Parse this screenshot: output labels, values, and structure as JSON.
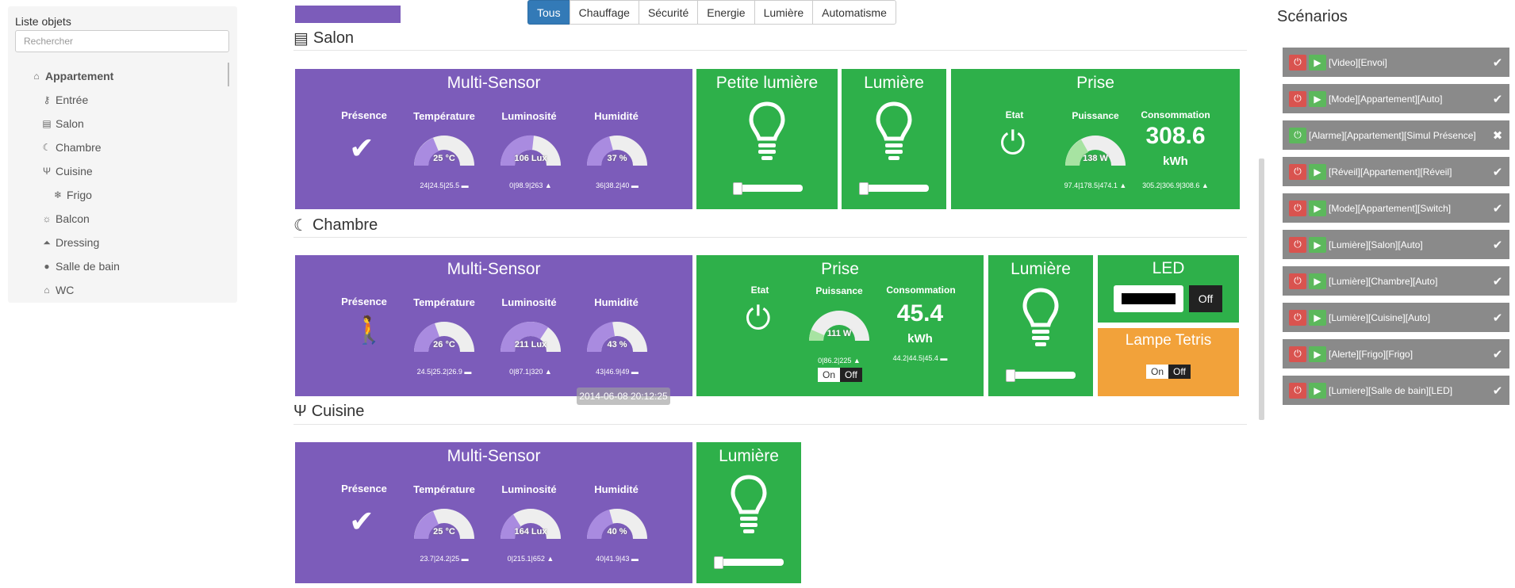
{
  "sidebar": {
    "title": "Liste objets",
    "search_placeholder": "Rechercher",
    "items": [
      {
        "label": "Appartement",
        "icon": "home-icon"
      },
      {
        "label": "Entrée",
        "icon": "key-icon"
      },
      {
        "label": "Salon",
        "icon": "film-icon"
      },
      {
        "label": "Chambre",
        "icon": "moon-icon"
      },
      {
        "label": "Cuisine",
        "icon": "cutlery-icon"
      },
      {
        "label": "Frigo",
        "icon": "snowflake-icon"
      },
      {
        "label": "Balcon",
        "icon": "sun-icon"
      },
      {
        "label": "Dressing",
        "icon": "hanger-icon"
      },
      {
        "label": "Salle de bain",
        "icon": "drop-icon"
      },
      {
        "label": "WC",
        "icon": "toilet-icon"
      }
    ]
  },
  "tabs": [
    "Tous",
    "Chauffage",
    "Sécurité",
    "Energie",
    "Lumière",
    "Automatisme"
  ],
  "sections": {
    "salon": "Salon",
    "chambre": "Chambre",
    "cuisine": "Cuisine"
  },
  "labels": {
    "presence": "Présence",
    "temperature": "Température",
    "luminosite": "Luminosité",
    "humidite": "Humidité",
    "etat": "Etat",
    "puissance": "Puissance",
    "consommation": "Consommation",
    "kwh": "kWh",
    "on": "On",
    "off": "Off"
  },
  "salon": {
    "multisensor": {
      "title": "Multi-Sensor",
      "temp": "25 °C",
      "temp_hist": "24|24.5|25.5",
      "lum": "106 Lux",
      "lum_hist": "0|98.9|263",
      "hum": "37 %",
      "hum_hist": "36|38.2|40"
    },
    "petite_lumiere": {
      "title": "Petite lumière"
    },
    "lumiere": {
      "title": "Lumière"
    },
    "prise": {
      "title": "Prise",
      "puissance": "138 W",
      "puissance_hist": "97.4|178.5|474.1",
      "conso": "308.6",
      "conso_hist": "305.2|306.9|308.6"
    }
  },
  "chambre": {
    "multisensor": {
      "title": "Multi-Sensor",
      "temp": "26 °C",
      "temp_hist": "24.5|25.2|26.9",
      "lum": "211 Lux",
      "lum_hist": "0|87.1|320",
      "hum": "43 %",
      "hum_hist": "43|46.9|49"
    },
    "prise": {
      "title": "Prise",
      "puissance": "111 W",
      "puissance_hist": "0|86.2|225",
      "conso": "45.4",
      "conso_hist": "44.2|44.5|45.4"
    },
    "lumiere": {
      "title": "Lumière"
    },
    "led": {
      "title": "LED",
      "off": "Off"
    },
    "lampe": {
      "title": "Lampe Tetris"
    },
    "tooltip": "2014-06-08 20:12:25"
  },
  "cuisine": {
    "multisensor": {
      "title": "Multi-Sensor",
      "temp": "25 °C",
      "temp_hist": "23.7|24.2|25",
      "lum": "164 Lux",
      "lum_hist": "0|215.1|652",
      "hum": "40 %",
      "hum_hist": "40|41.9|43"
    },
    "lumiere": {
      "title": "Lumière"
    }
  },
  "scenarios": {
    "title": "Scénarios",
    "items": [
      {
        "name": "[Video][Envoi]",
        "state": "check"
      },
      {
        "name": "[Mode][Appartement][Auto]",
        "state": "check"
      },
      {
        "name": "[Alarme][Appartement][Simul Présence]",
        "state": "cross"
      },
      {
        "name": "[Réveil][Appartement][Réveil]",
        "state": "check"
      },
      {
        "name": "[Mode][Appartement][Switch]",
        "state": "check"
      },
      {
        "name": "[Lumière][Salon][Auto]",
        "state": "check"
      },
      {
        "name": "[Lumière][Chambre][Auto]",
        "state": "check"
      },
      {
        "name": "[Lumière][Cuisine][Auto]",
        "state": "check"
      },
      {
        "name": "[Alerte][Frigo][Frigo]",
        "state": "check"
      },
      {
        "name": "[Lumiere][Salle de bain][LED]",
        "state": "check"
      }
    ]
  },
  "colors": {
    "purple": "#7c5cba",
    "green": "#2eb04a",
    "orange": "#f2a23a",
    "tab_active": "#337ab7"
  }
}
